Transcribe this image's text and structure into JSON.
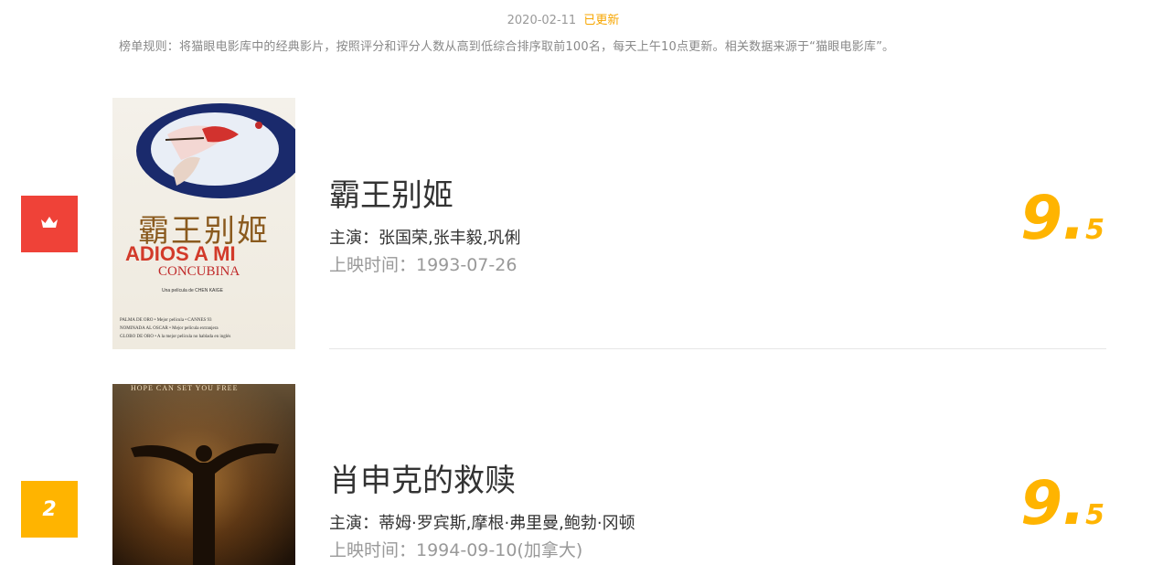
{
  "header": {
    "date": "2020-02-11",
    "updated_label": "已更新",
    "rules": "榜单规则：将猫眼电影库中的经典影片，按照评分和评分人数从高到低综合排序取前100名，每天上午10点更新。相关数据来源于“猫眼电影库”。"
  },
  "movies": [
    {
      "rank": "1",
      "rank_icon": "crown-icon",
      "title": "霸王别姬",
      "stars": "主演：张国荣,张丰毅,巩俐",
      "release": "上映时间：1993-07-26",
      "score_int": "9.",
      "score_frac": "5",
      "poster": {
        "title_cn": "霸王别姬",
        "title_en": "ADIOS A MI",
        "subtitle_en": "CONCUBINA",
        "director_line": "Una película de CHEN KAIGE",
        "credits": [
          "PALMA DE ORO • Mejor película • CANNES 93",
          "NOMINADA AL OSCAR • Mejor película extranjera",
          "GLOBO DE ORO • A la mejor película no hablada en inglés"
        ]
      }
    },
    {
      "rank": "2",
      "title": "肖申克的救赎",
      "stars": "主演：蒂姆·罗宾斯,摩根·弗里曼,鲍勃·冈顿",
      "release": "上映时间：1994-09-10(加拿大)",
      "score_int": "9.",
      "score_frac": "5",
      "poster": {
        "tagline": "HOPE CAN SET YOU FREE"
      }
    }
  ],
  "colors": {
    "accent": "#ffb400",
    "rank_first": "#ef4238",
    "muted": "#999999"
  }
}
